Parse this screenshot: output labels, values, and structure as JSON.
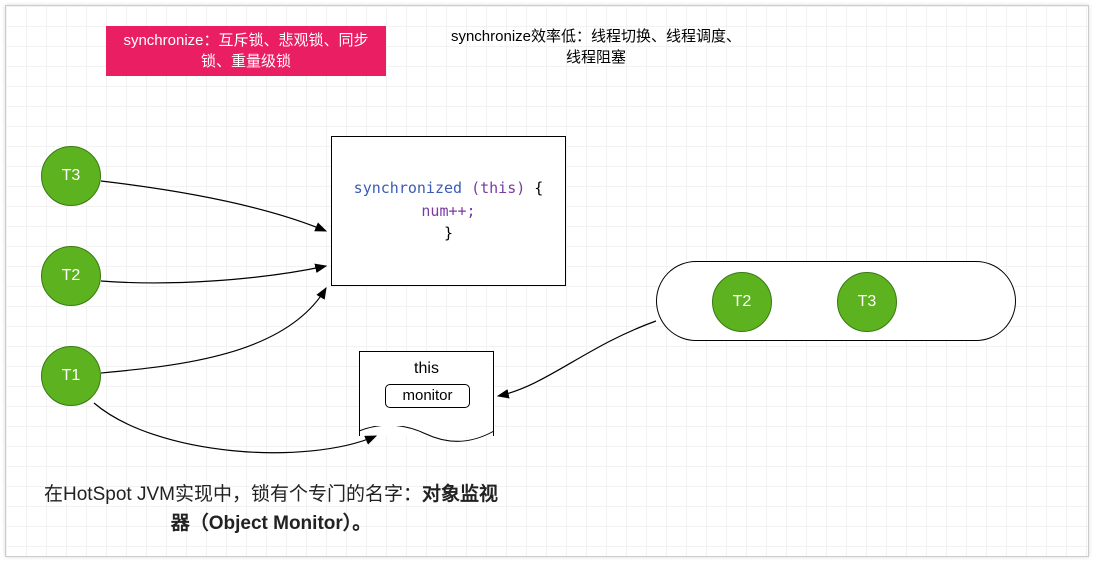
{
  "header": {
    "pink_box": "synchronize：互斥锁、悲观锁、同步锁、重量级锁",
    "right_text": "synchronize效率低：线程切换、线程调度、线程阻塞"
  },
  "threads": {
    "t1": "T1",
    "t2": "T2",
    "t3": "T3"
  },
  "code": {
    "kw": "synchronized",
    "this": "(this)",
    "open": " {",
    "body": "num++;",
    "close": "}"
  },
  "monitor": {
    "this_label": "this",
    "monitor_label": "monitor"
  },
  "queue": {
    "item1": "T2",
    "item2": "T3"
  },
  "footer": {
    "prefix": "在HotSpot JVM实现中，锁有个专门的名字：",
    "bold": "对象监视器（Object Monitor）。"
  }
}
